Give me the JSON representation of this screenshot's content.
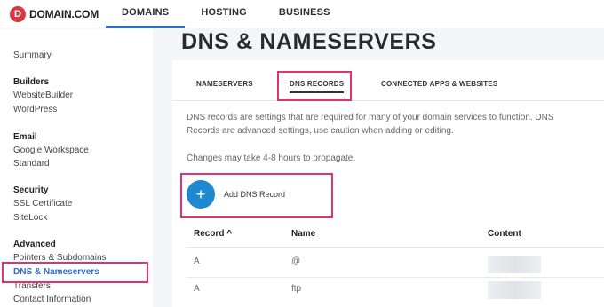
{
  "brand": {
    "mark": "D",
    "name": "DOMAIN.COM"
  },
  "topnav": [
    "DOMAINS",
    "HOSTING",
    "BUSINESS"
  ],
  "sidebar": {
    "summary": "Summary",
    "builders": {
      "title": "Builders",
      "items": [
        "WebsiteBuilder",
        "WordPress"
      ]
    },
    "email": {
      "title": "Email",
      "items": [
        "Google Workspace",
        "Standard"
      ]
    },
    "security": {
      "title": "Security",
      "items": [
        "SSL Certificate",
        "SiteLock"
      ]
    },
    "advanced": {
      "title": "Advanced",
      "items": [
        "Pointers & Subdomains",
        "DNS & Nameservers",
        "Transfers",
        "Contact Information"
      ]
    }
  },
  "page": {
    "title": "DNS & NAMESERVERS",
    "tabs": [
      "NAMESERVERS",
      "DNS RECORDS",
      "CONNECTED APPS & WEBSITES"
    ],
    "description": "DNS records are settings that are required for many of your domain services to function. DNS Records are advanced settings, use caution when adding or editing.",
    "note": "Changes may take 4-8 hours to propagate.",
    "add_label": "Add DNS Record",
    "add_icon": "+",
    "table": {
      "headers": [
        "Record ^",
        "Name",
        "Content"
      ],
      "rows": [
        {
          "record": "A",
          "name": "@"
        },
        {
          "record": "A",
          "name": "ftp"
        }
      ]
    }
  },
  "colors": {
    "accent": "#2f6ccf",
    "highlight": "#e0336e",
    "add_button": "#1e88d0",
    "logo": "#d93742"
  }
}
